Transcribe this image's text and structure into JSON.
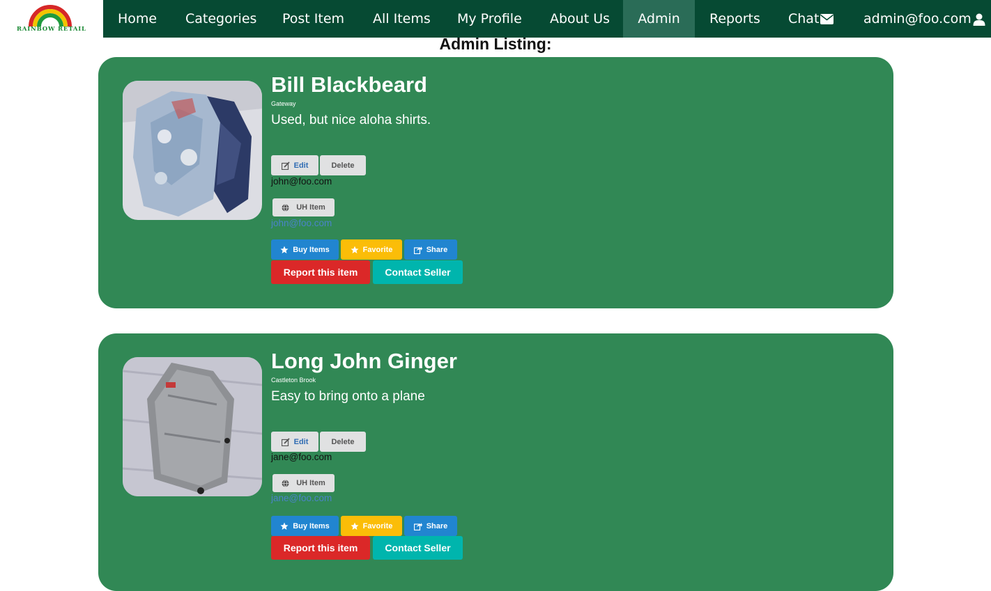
{
  "brand": {
    "logo_text": "RAINBOW RETAIL"
  },
  "nav": {
    "items": [
      {
        "label": "Home"
      },
      {
        "label": "Categories"
      },
      {
        "label": "Post Item"
      },
      {
        "label": "All Items"
      },
      {
        "label": "My Profile"
      },
      {
        "label": "About Us"
      },
      {
        "label": "Admin"
      },
      {
        "label": "Reports"
      },
      {
        "label": "Chat"
      }
    ],
    "active": "Admin",
    "user": "admin@foo.com",
    "icons": {
      "chat": "envelope-icon",
      "user": "user-icon"
    }
  },
  "page": {
    "title": "Admin Listing:"
  },
  "listings": [
    {
      "name": "Bill Blackbeard",
      "location": "Gateway",
      "description": "Used, but nice aloha shirts.",
      "image": "aloha-shirts-photo",
      "owner": "john@foo.com",
      "uh_label": "UH Item",
      "contact": "john@foo.com"
    },
    {
      "name": "Long John Ginger",
      "location": "Castleton Brook",
      "description": "Easy to bring onto a plane",
      "image": "silver-suitcase-photo",
      "owner": "jane@foo.com",
      "uh_label": "UH Item",
      "contact": "jane@foo.com"
    }
  ],
  "actions": {
    "edit": "Edit",
    "delete": "Delete",
    "buy": "Buy Items",
    "favorite": "Favorite",
    "share": "Share",
    "report": "Report this item",
    "contact": "Contact Seller"
  },
  "colors": {
    "nav_bg": "#064a33",
    "nav_active": "#2a6c57",
    "card_bg": "#318855",
    "blue": "#2185d0",
    "yellow": "#fbbd08",
    "red": "#db2828",
    "teal": "#00b5ad"
  }
}
